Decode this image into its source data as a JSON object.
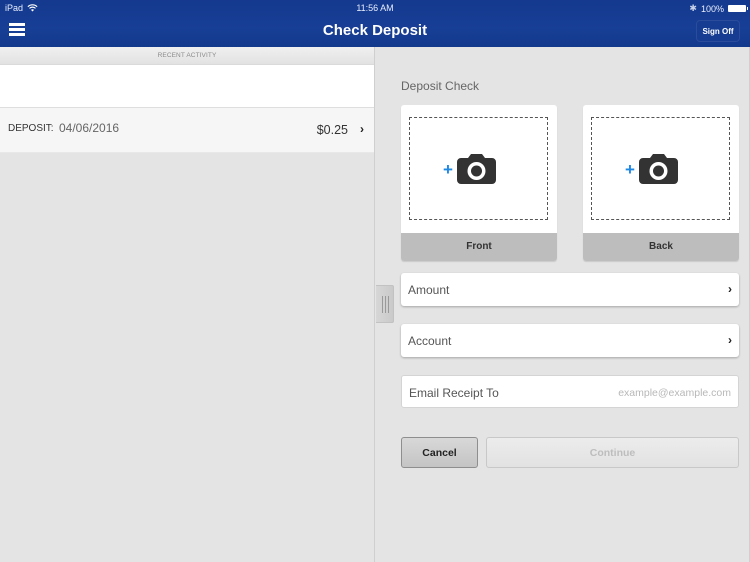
{
  "status_bar": {
    "device": "iPad",
    "time": "11:56 AM",
    "battery": "100%",
    "icons": [
      "wifi-icon",
      "bluetooth-icon",
      "battery-icon"
    ]
  },
  "header": {
    "title": "Check Deposit",
    "menu_icon": "hamburger-menu-icon",
    "sign_off_label": "Sign Off"
  },
  "recent_activity": {
    "section_title": "RECENT ACTIVITY",
    "items": [
      {
        "type": "DEPOSIT:",
        "date": "04/06/2016",
        "amount": "$0.25"
      }
    ]
  },
  "deposit_form": {
    "title": "Deposit Check",
    "capture": [
      {
        "label": "Front",
        "icon": "add-camera-icon"
      },
      {
        "label": "Back",
        "icon": "add-camera-icon"
      }
    ],
    "amount_label": "Amount",
    "account_label": "Account",
    "email_label": "Email Receipt To",
    "email_placeholder": "example@example.com",
    "cancel_label": "Cancel",
    "continue_label": "Continue"
  },
  "colors": {
    "header_blue": "#163d92",
    "accent_blue": "#1e88e5",
    "background": "#e4e4e4"
  }
}
